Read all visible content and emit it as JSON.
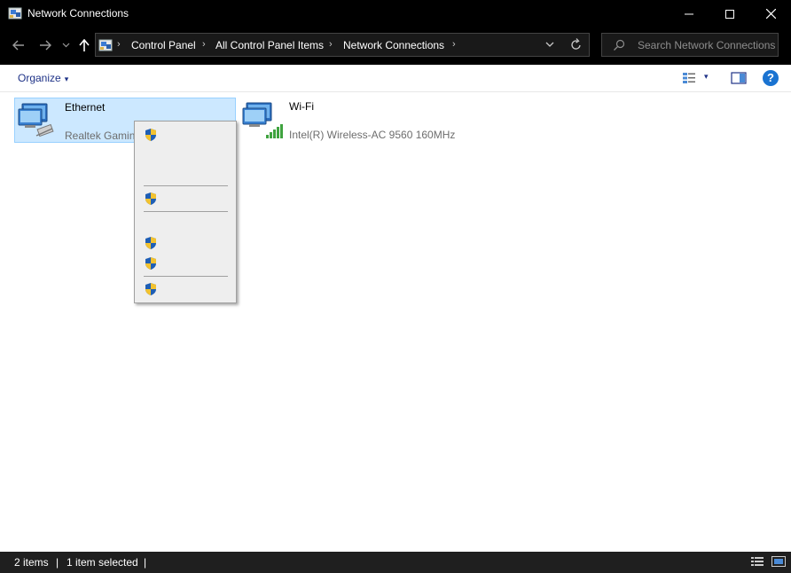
{
  "window": {
    "title": "Network Connections",
    "icon": "network-connections-app-icon"
  },
  "nav": {
    "back_icon": "arrow-left-icon",
    "forward_icon": "arrow-right-icon",
    "recent_icon": "chevron-down-icon",
    "up_icon": "arrow-up-icon",
    "breadcrumbs": [
      "Control Panel",
      "All Control Panel Items",
      "Network Connections"
    ],
    "search_placeholder": "Search Network Connections"
  },
  "toolbar": {
    "organize_label": "Organize",
    "caret": "▾"
  },
  "items": [
    {
      "name": "Ethernet",
      "description": "Realtek Gaming",
      "selected": true,
      "icon": "ethernet-adapter-icon"
    },
    {
      "name": "Wi-Fi",
      "description": "Intel(R) Wireless-AC 9560 160MHz",
      "selected": false,
      "icon": "wifi-adapter-icon"
    }
  ],
  "context_menu": {
    "entries": [
      {
        "type": "item",
        "shield": true,
        "label": ""
      },
      {
        "type": "item",
        "shield": false,
        "label": ""
      },
      {
        "type": "separator"
      },
      {
        "type": "item",
        "shield": true,
        "label": ""
      },
      {
        "type": "separator"
      },
      {
        "type": "item",
        "shield": true,
        "label": ""
      },
      {
        "type": "item",
        "shield": true,
        "label": ""
      },
      {
        "type": "separator"
      },
      {
        "type": "item",
        "shield": true,
        "label": ""
      }
    ]
  },
  "status": {
    "item_count": "2 items",
    "selection": "1 item selected",
    "separator": "|"
  },
  "colors": {
    "titlebar_bg": "#000000",
    "selection_bg": "#cce8ff",
    "selection_border": "#99d1ff",
    "link_blue": "#1e3287",
    "statusbar_bg": "#1f1f1f"
  }
}
